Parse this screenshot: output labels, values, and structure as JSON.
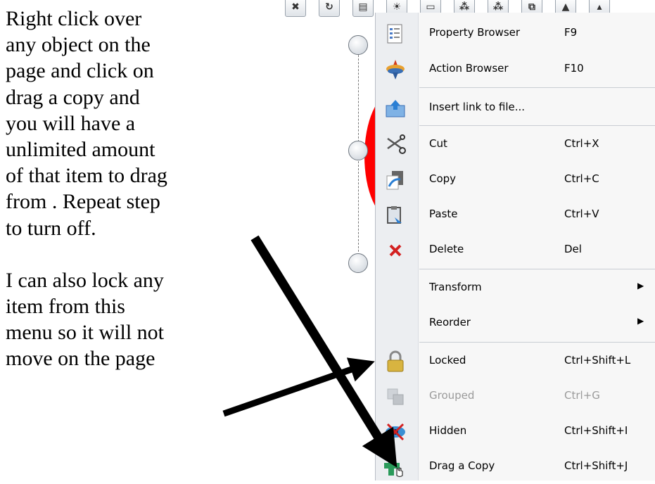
{
  "instructions": {
    "paragraph1": "Right click over\nany object on the\npage and click on\ndrag a copy and\nyou will have a\nunlimited  amount\nof that item  to drag\nfrom .  Repeat step\nto turn off.",
    "paragraph2": "I can also lock any\nitem from this\nmenu so it will not\nmove on the  page"
  },
  "toolbar": {
    "buttons": [
      {
        "glyph": "✖",
        "icon": "close-icon"
      },
      {
        "glyph": "↻",
        "icon": "redo-icon"
      },
      {
        "glyph": "▤",
        "icon": "document-icon"
      },
      {
        "glyph": "☀",
        "icon": "light-icon"
      },
      {
        "glyph": "▭",
        "icon": "frame-icon"
      },
      {
        "glyph": "⁂",
        "icon": "grid-icon"
      },
      {
        "glyph": "⁂",
        "icon": "grid-icon-2"
      },
      {
        "glyph": "⧉",
        "icon": "copy-window-icon"
      },
      {
        "glyph": "▲",
        "icon": "align-up-icon"
      },
      {
        "glyph": "▴",
        "icon": "arrow-up-icon"
      }
    ]
  },
  "menu": {
    "property_browser": {
      "label": "Property Browser",
      "shortcut": "F9",
      "icon": "property-browser-icon"
    },
    "action_browser": {
      "label": "Action Browser",
      "shortcut": "F10",
      "icon": "action-browser-icon"
    },
    "insert_link": {
      "label": "Insert link to file...",
      "shortcut": "",
      "icon": "insert-link-icon"
    },
    "cut": {
      "label": "Cut",
      "shortcut": "Ctrl+X",
      "icon": "scissors-icon"
    },
    "copy": {
      "label": "Copy",
      "shortcut": "Ctrl+C",
      "icon": "copy-icon"
    },
    "paste": {
      "label": "Paste",
      "shortcut": "Ctrl+V",
      "icon": "paste-icon"
    },
    "delete": {
      "label": "Delete",
      "shortcut": "Del",
      "icon": "delete-icon"
    },
    "transform": {
      "label": "Transform",
      "icon": "submenu-arrow-icon"
    },
    "reorder": {
      "label": "Reorder",
      "icon": "submenu-arrow-icon"
    },
    "locked": {
      "label": "Locked",
      "shortcut": "Ctrl+Shift+L",
      "icon": "lock-icon"
    },
    "grouped": {
      "label": "Grouped",
      "shortcut": "Ctrl+G",
      "icon": "group-icon"
    },
    "hidden": {
      "label": "Hidden",
      "shortcut": "Ctrl+Shift+I",
      "icon": "hidden-eye-icon"
    },
    "drag_copy": {
      "label": "Drag a Copy",
      "shortcut": "Ctrl+Shift+J",
      "icon": "drag-copy-icon"
    }
  },
  "colors": {
    "shape_red": "#ff0000",
    "arrow": "#000000",
    "menu_bg": "#f7f7f7"
  }
}
